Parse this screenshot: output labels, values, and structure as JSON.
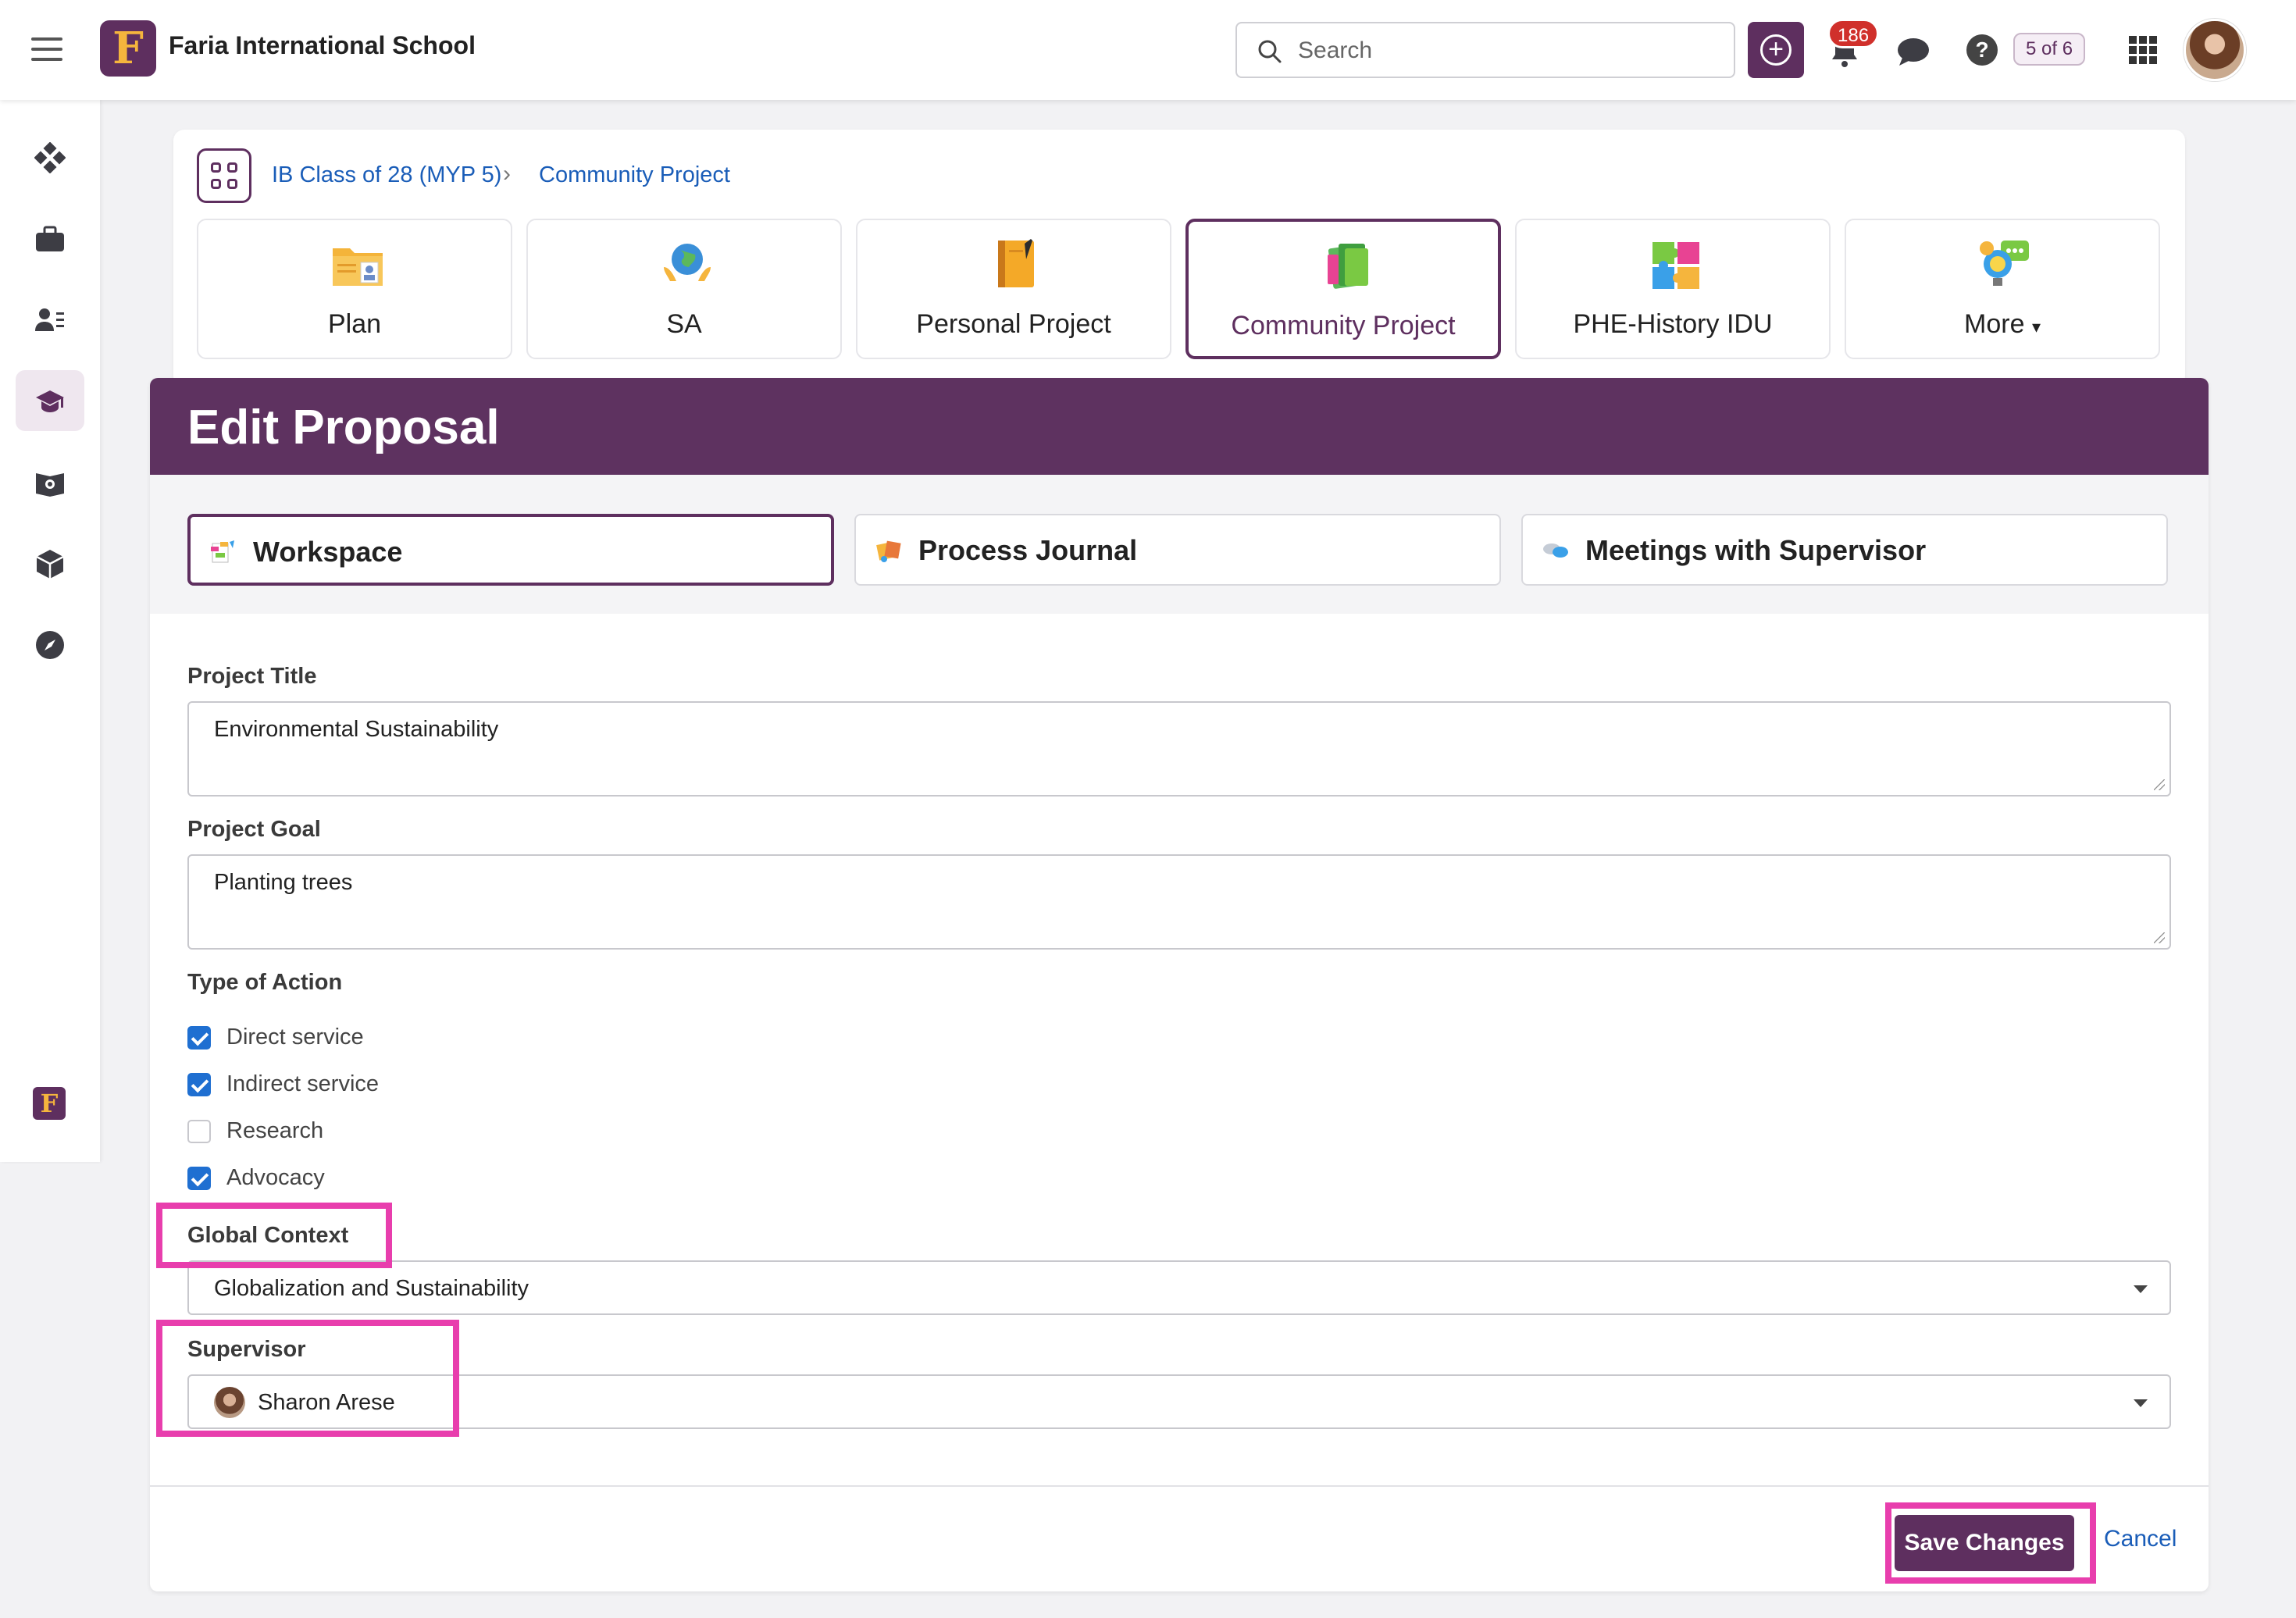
{
  "topbar": {
    "logo_letter": "F",
    "school_name": "Faria International School",
    "search_placeholder": "Search",
    "notification_count": "186",
    "counter": "5 of 6",
    "brand_color": "#5e2f5f",
    "icons": [
      "hamburger-icon",
      "plus-circle-icon",
      "bell-icon",
      "chat-icon",
      "help-icon",
      "apps-grid-icon",
      "user-avatar"
    ]
  },
  "sidebar": {
    "items": [
      {
        "icon": "dashboard-icon"
      },
      {
        "icon": "briefcase-icon"
      },
      {
        "icon": "people-list-icon"
      },
      {
        "icon": "graduation-cap-icon",
        "active": true
      },
      {
        "icon": "map-book-icon"
      },
      {
        "icon": "cube-icon"
      },
      {
        "icon": "compass-icon"
      }
    ],
    "footer_logo_letter": "F"
  },
  "breadcrumb": {
    "items": [
      "IB Class of 28 (MYP 5)",
      "Community Project"
    ],
    "separator": "›"
  },
  "tiles": [
    {
      "label": "Plan",
      "icon": "plan-folder-icon"
    },
    {
      "label": "SA",
      "icon": "globe-hands-icon"
    },
    {
      "label": "Personal Project",
      "icon": "notebook-icon"
    },
    {
      "label": "Community Project",
      "icon": "books-stack-icon",
      "active": true
    },
    {
      "label": "PHE-History IDU",
      "icon": "puzzle-icon"
    },
    {
      "label": "More",
      "icon": "lightbulb-chat-icon"
    }
  ],
  "panel": {
    "title": "Edit Proposal",
    "subtabs": [
      {
        "label": "Workspace",
        "icon": "workspace-icon",
        "active": true
      },
      {
        "label": "Process Journal",
        "icon": "journal-icon"
      },
      {
        "label": "Meetings with Supervisor",
        "icon": "chat-bubbles-icon"
      }
    ],
    "project_title_label": "Project Title",
    "project_title_value": "Environmental Sustainability",
    "project_goal_label": "Project Goal",
    "project_goal_value": "Planting trees",
    "type_of_action_label": "Type of Action",
    "type_of_action": [
      {
        "label": "Direct service",
        "checked": true
      },
      {
        "label": "Indirect service",
        "checked": true
      },
      {
        "label": "Research",
        "checked": false
      },
      {
        "label": "Advocacy",
        "checked": true
      }
    ],
    "global_context_label": "Global Context",
    "global_context_value": "Globalization and Sustainability",
    "supervisor_label": "Supervisor",
    "supervisor_value": "Sharon Arese",
    "save_label": "Save Changes",
    "cancel_label": "Cancel",
    "highlight_color": "#e83ead"
  }
}
